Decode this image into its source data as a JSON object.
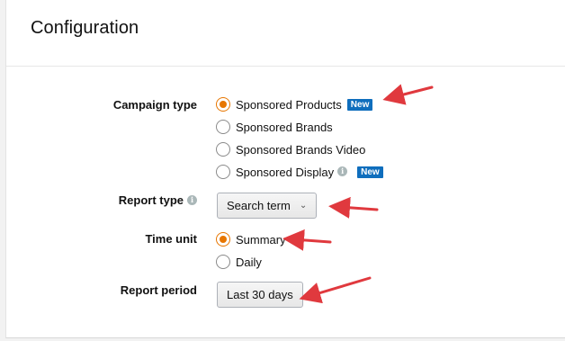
{
  "panel": {
    "title": "Configuration"
  },
  "campaign_type": {
    "label": "Campaign type",
    "options": [
      {
        "label": "Sponsored Products",
        "selected": true,
        "badge": "New",
        "info": false
      },
      {
        "label": "Sponsored Brands",
        "selected": false,
        "badge": "",
        "info": false
      },
      {
        "label": "Sponsored Brands Video",
        "selected": false,
        "badge": "",
        "info": false
      },
      {
        "label": "Sponsored Display",
        "selected": false,
        "badge": "New",
        "info": true
      }
    ]
  },
  "report_type": {
    "label": "Report type",
    "value": "Search term"
  },
  "time_unit": {
    "label": "Time unit",
    "options": [
      {
        "label": "Summary",
        "selected": true
      },
      {
        "label": "Daily",
        "selected": false
      }
    ]
  },
  "report_period": {
    "label": "Report period",
    "value": "Last 30 days"
  },
  "colors": {
    "accent_radio": "#e77600",
    "badge": "#0f6ebd",
    "annotation_arrow": "#e0393e"
  },
  "icons": {
    "info": "info-icon",
    "dropdown": "chevron-down-icon",
    "annotation": "red-arrow"
  }
}
